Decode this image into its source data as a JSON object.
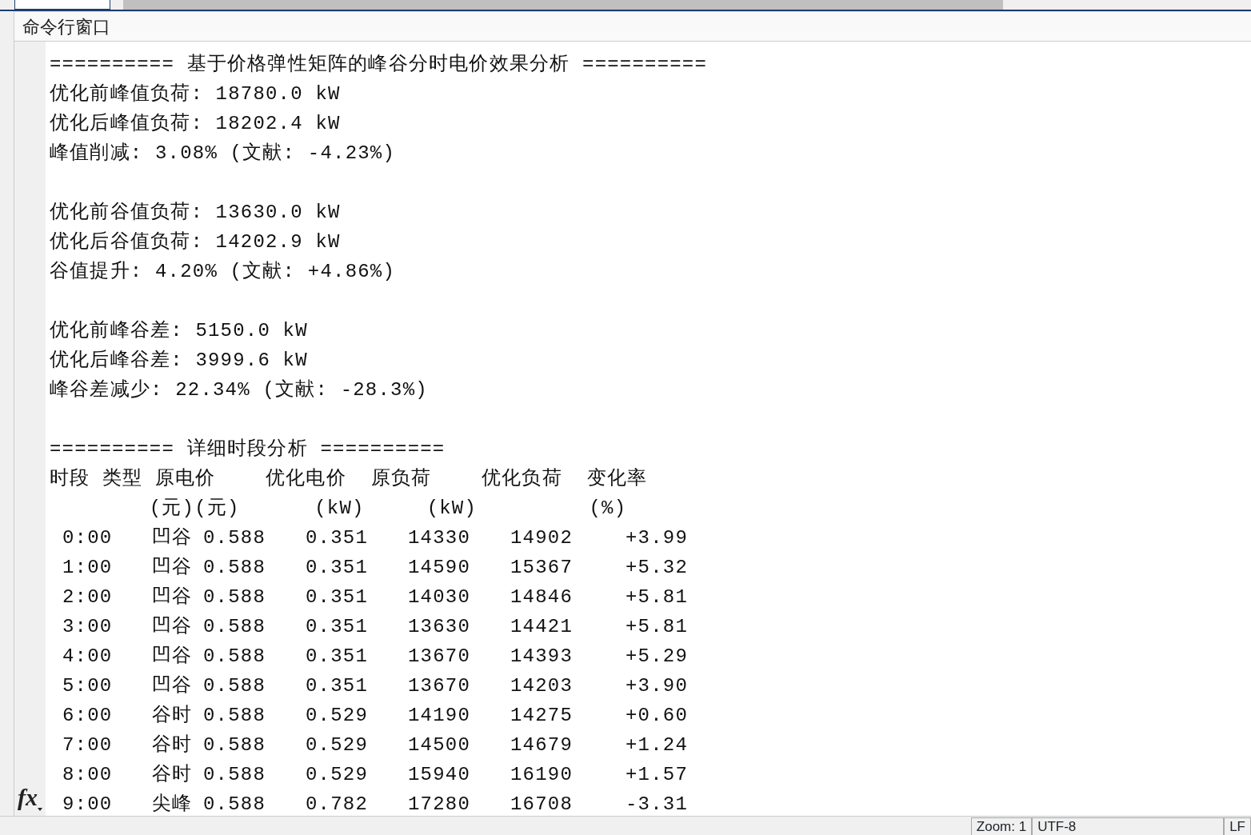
{
  "window": {
    "title": "命令行窗口"
  },
  "summary_blocks": [
    [
      "========== 基于价格弹性矩阵的峰谷分时电价效果分析 ==========",
      "优化前峰值负荷: 18780.0 kW",
      "优化后峰值负荷: 18202.4 kW",
      "峰值削减: 3.08% (文献: -4.23%)"
    ],
    [
      "优化前谷值负荷: 13630.0 kW",
      "优化后谷值负荷: 14202.9 kW",
      "谷值提升: 4.20% (文献: +4.86%)"
    ],
    [
      "优化前峰谷差: 5150.0 kW",
      "优化后峰谷差: 3999.6 kW",
      "峰谷差减少: 22.34% (文献: -28.3%)"
    ]
  ],
  "detail": {
    "heading": "========== 详细时段分析 ==========",
    "header_line": "时段 类型 原电价    优化电价  原负荷    优化负荷  变化率",
    "unit_line": "        (元)(元)      (kW)     (kW)         (%)",
    "rows": [
      [
        "0:00",
        "凹谷",
        "0.588",
        "0.351",
        "14330",
        "14902",
        "+3.99"
      ],
      [
        "1:00",
        "凹谷",
        "0.588",
        "0.351",
        "14590",
        "15367",
        "+5.32"
      ],
      [
        "2:00",
        "凹谷",
        "0.588",
        "0.351",
        "14030",
        "14846",
        "+5.81"
      ],
      [
        "3:00",
        "凹谷",
        "0.588",
        "0.351",
        "13630",
        "14421",
        "+5.81"
      ],
      [
        "4:00",
        "凹谷",
        "0.588",
        "0.351",
        "13670",
        "14393",
        "+5.29"
      ],
      [
        "5:00",
        "凹谷",
        "0.588",
        "0.351",
        "13670",
        "14203",
        "+3.90"
      ],
      [
        "6:00",
        "谷时",
        "0.588",
        "0.529",
        "14190",
        "14275",
        "+0.60"
      ],
      [
        "7:00",
        "谷时",
        "0.588",
        "0.529",
        "14500",
        "14679",
        "+1.24"
      ],
      [
        "8:00",
        "谷时",
        "0.588",
        "0.529",
        "15940",
        "16190",
        "+1.57"
      ],
      [
        "9:00",
        "尖峰",
        "0.588",
        "0.782",
        "17280",
        "16708",
        "-3.31"
      ]
    ]
  },
  "function_button": "fx",
  "status_bar": [
    "Zoom: 1",
    "UTF-8",
    "LF"
  ]
}
